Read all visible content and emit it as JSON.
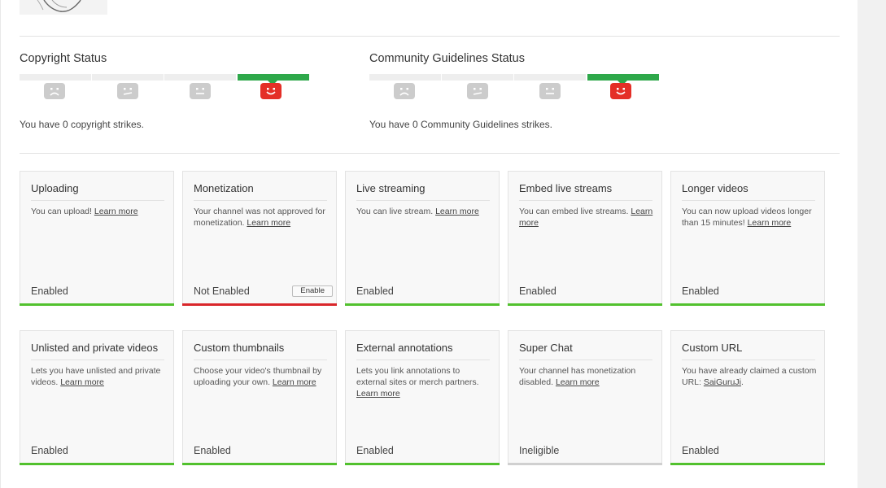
{
  "colors": {
    "enabled": "#52c12e",
    "not_enabled": "#d9262a",
    "ineligible": "#d0d0d0",
    "good_standing": "#2ea84a",
    "face_active": "#e42f27",
    "face_inactive": "#cccccc"
  },
  "copyright": {
    "title": "Copyright Status",
    "text": "You have 0 copyright strikes.",
    "strikes": 0,
    "faces": [
      "sad-face-icon",
      "meh-face-icon",
      "neutral-face-icon",
      "smile-face-icon"
    ]
  },
  "community": {
    "title": "Community Guidelines Status",
    "text": "You have 0 Community Guidelines strikes.",
    "strikes": 0,
    "faces": [
      "sad-face-icon",
      "meh-face-icon",
      "neutral-face-icon",
      "smile-face-icon"
    ]
  },
  "features": [
    {
      "title": "Uploading",
      "desc": "You can upload! ",
      "link": "Learn more",
      "state": "Enabled",
      "status": "enabled"
    },
    {
      "title": "Monetization",
      "desc": "Your channel was not approved for monetization. ",
      "link": "Learn more",
      "state": "Not Enabled",
      "status": "not_enabled",
      "button": "Enable"
    },
    {
      "title": "Live streaming",
      "desc": "You can live stream. ",
      "link": "Learn more",
      "state": "Enabled",
      "status": "enabled"
    },
    {
      "title": "Embed live streams",
      "desc": "You can embed live streams. ",
      "link": "Learn more",
      "state": "Enabled",
      "status": "enabled"
    },
    {
      "title": "Longer videos",
      "desc": "You can now upload videos longer than 15 minutes! ",
      "link": "Learn more",
      "state": "Enabled",
      "status": "enabled"
    },
    {
      "title": "Unlisted and private videos",
      "desc": "Lets you have unlisted and private videos. ",
      "link": "Learn more",
      "state": "Enabled",
      "status": "enabled"
    },
    {
      "title": "Custom thumbnails",
      "desc": "Choose your video's thumbnail by uploading your own. ",
      "link": "Learn more",
      "state": "Enabled",
      "status": "enabled"
    },
    {
      "title": "External annotations",
      "desc": "Lets you link annotations to external sites or merch partners. ",
      "link": "Learn more",
      "state": "Enabled",
      "status": "enabled"
    },
    {
      "title": "Super Chat",
      "desc": "Your channel has monetization disabled. ",
      "link": "Learn more",
      "state": "Ineligible",
      "status": "ineligible"
    },
    {
      "title": "Custom URL",
      "desc": "You have already claimed a custom URL: ",
      "link": "SaiGuruJi",
      "suffix": ".",
      "state": "Enabled",
      "status": "enabled"
    }
  ]
}
